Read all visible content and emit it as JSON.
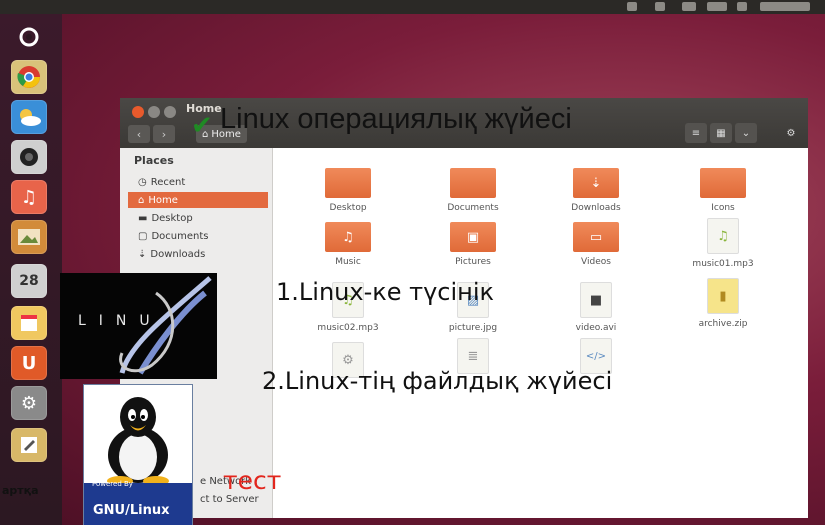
{
  "slide": {
    "title": "Linux операциялық жүйесі",
    "point1": "1.Linux-ке түсінік",
    "point2": "2.Linux-тің файлдық жүйесі",
    "test_link": "тест",
    "back_link": "артқа"
  },
  "colors": {
    "check": "#1f8a24",
    "test_link": "#e2261d",
    "folder": "#e8744a",
    "selection": "#e36a3f",
    "desktop_bg": "#7a1d3a"
  },
  "launcher": {
    "items": [
      {
        "icon": "dash-home-icon"
      },
      {
        "icon": "chrome-icon"
      },
      {
        "icon": "weather-icon"
      },
      {
        "icon": "webcam-icon"
      },
      {
        "icon": "music-player-icon"
      },
      {
        "icon": "image-viewer-icon"
      },
      {
        "icon": "calendar-icon",
        "label": "28"
      },
      {
        "icon": "notes-icon"
      },
      {
        "icon": "ubuntu-one-icon",
        "label": "U"
      },
      {
        "icon": "settings-gear-icon"
      },
      {
        "icon": "text-editor-icon"
      }
    ]
  },
  "file_manager": {
    "window_title": "Home",
    "path_button": "Home",
    "sidebar": {
      "header": "Places",
      "items": [
        {
          "label": "Recent",
          "icon": "clock-icon",
          "selected": false
        },
        {
          "label": "Home",
          "icon": "home-icon",
          "selected": true
        },
        {
          "label": "Desktop",
          "icon": "desktop-folder-icon",
          "selected": false
        },
        {
          "label": "Documents",
          "icon": "documents-icon",
          "selected": false
        },
        {
          "label": "Downloads",
          "icon": "downloads-icon",
          "selected": false
        }
      ],
      "network_partial": "e Network",
      "connect_partial": "ct to Server"
    },
    "files": [
      {
        "name": "Desktop",
        "icon": "folder-icon"
      },
      {
        "name": "Documents",
        "icon": "folder-icon"
      },
      {
        "name": "Downloads",
        "icon": "downloads-folder-icon"
      },
      {
        "name": "Icons",
        "icon": "folder-icon"
      },
      {
        "name": "Music",
        "icon": "music-folder-icon"
      },
      {
        "name": "Pictures",
        "icon": "pictures-folder-icon"
      },
      {
        "name": "Videos",
        "icon": "videos-folder-icon"
      },
      {
        "name": "music01.mp3",
        "icon": "audio-file-icon"
      },
      {
        "name": "music02.mp3",
        "icon": "audio-file-icon"
      },
      {
        "name": "picture.jpg",
        "icon": "image-file-icon"
      },
      {
        "name": "video.avi",
        "icon": "video-file-icon"
      },
      {
        "name": "archive.zip",
        "icon": "archive-file-icon"
      }
    ]
  },
  "badges": {
    "linux_logo_text": "LINUX",
    "powered_by": "Powered By",
    "gnu_linux": "GNU/Linux"
  }
}
